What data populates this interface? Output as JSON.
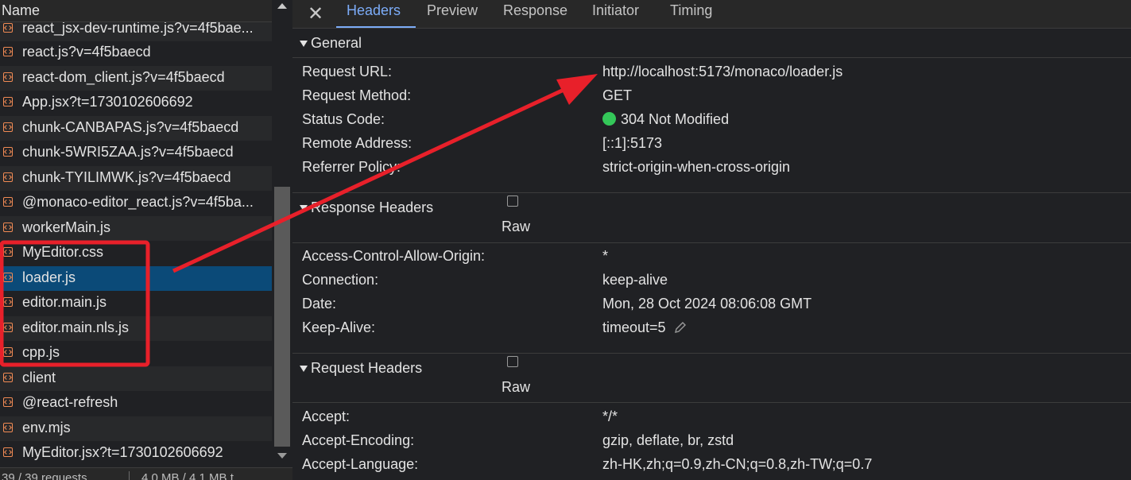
{
  "network_list": {
    "column_header": "Name",
    "rows": [
      {
        "name": "react_jsx-dev-runtime.js?v=4f5bae..."
      },
      {
        "name": "react.js?v=4f5baecd"
      },
      {
        "name": "react-dom_client.js?v=4f5baecd"
      },
      {
        "name": "App.jsx?t=1730102606692"
      },
      {
        "name": "chunk-CANBAPAS.js?v=4f5baecd"
      },
      {
        "name": "chunk-5WRI5ZAA.js?v=4f5baecd"
      },
      {
        "name": "chunk-TYILIMWK.js?v=4f5baecd"
      },
      {
        "name": "@monaco-editor_react.js?v=4f5ba..."
      },
      {
        "name": "workerMain.js"
      },
      {
        "name": "MyEditor.css"
      },
      {
        "name": "loader.js"
      },
      {
        "name": "editor.main.js"
      },
      {
        "name": "editor.main.nls.js"
      },
      {
        "name": "cpp.js"
      },
      {
        "name": "client"
      },
      {
        "name": "@react-refresh"
      },
      {
        "name": "env.mjs"
      },
      {
        "name": "MyEditor.jsx?t=1730102606692"
      }
    ],
    "selected_row": "loader.js",
    "status_requests": "39 / 39 requests",
    "status_transferred": "4.0 MB / 4.1 MB t"
  },
  "tabs": [
    "Headers",
    "Preview",
    "Response",
    "Initiator",
    "Timing"
  ],
  "active_tab": "Headers",
  "general": {
    "title": "General",
    "rows": [
      {
        "key": "Request URL:",
        "value": "http://localhost:5173/monaco/loader.js"
      },
      {
        "key": "Request Method:",
        "value": "GET"
      },
      {
        "key": "Status Code:",
        "value": "304 Not Modified"
      },
      {
        "key": "Remote Address:",
        "value": "[::1]:5173"
      },
      {
        "key": "Referrer Policy:",
        "value": "strict-origin-when-cross-origin"
      }
    ]
  },
  "response_headers": {
    "title": "Response Headers",
    "raw_label": "Raw",
    "rows": [
      {
        "key": "Access-Control-Allow-Origin:",
        "value": "*"
      },
      {
        "key": "Connection:",
        "value": "keep-alive"
      },
      {
        "key": "Date:",
        "value": "Mon, 28 Oct 2024 08:06:08 GMT"
      },
      {
        "key": "Keep-Alive:",
        "value": "timeout=5"
      }
    ]
  },
  "request_headers": {
    "title": "Request Headers",
    "raw_label": "Raw",
    "rows": [
      {
        "key": "Accept:",
        "value": "*/*"
      },
      {
        "key": "Accept-Encoding:",
        "value": "gzip, deflate, br, zstd"
      },
      {
        "key": "Accept-Language:",
        "value": "zh-HK,zh;q=0.9,zh-CN;q=0.8,zh-TW;q=0.7"
      }
    ]
  },
  "colors": {
    "accent": "#7cacf8",
    "selected_row": "#0b4a78",
    "status_ok": "#34c759",
    "annotation": "#e8202a",
    "file_icon": "#f28b54"
  },
  "icons": {
    "close": "close-icon",
    "file": "file-code-icon",
    "status": "status-dot-icon",
    "edit": "pencil-icon"
  }
}
